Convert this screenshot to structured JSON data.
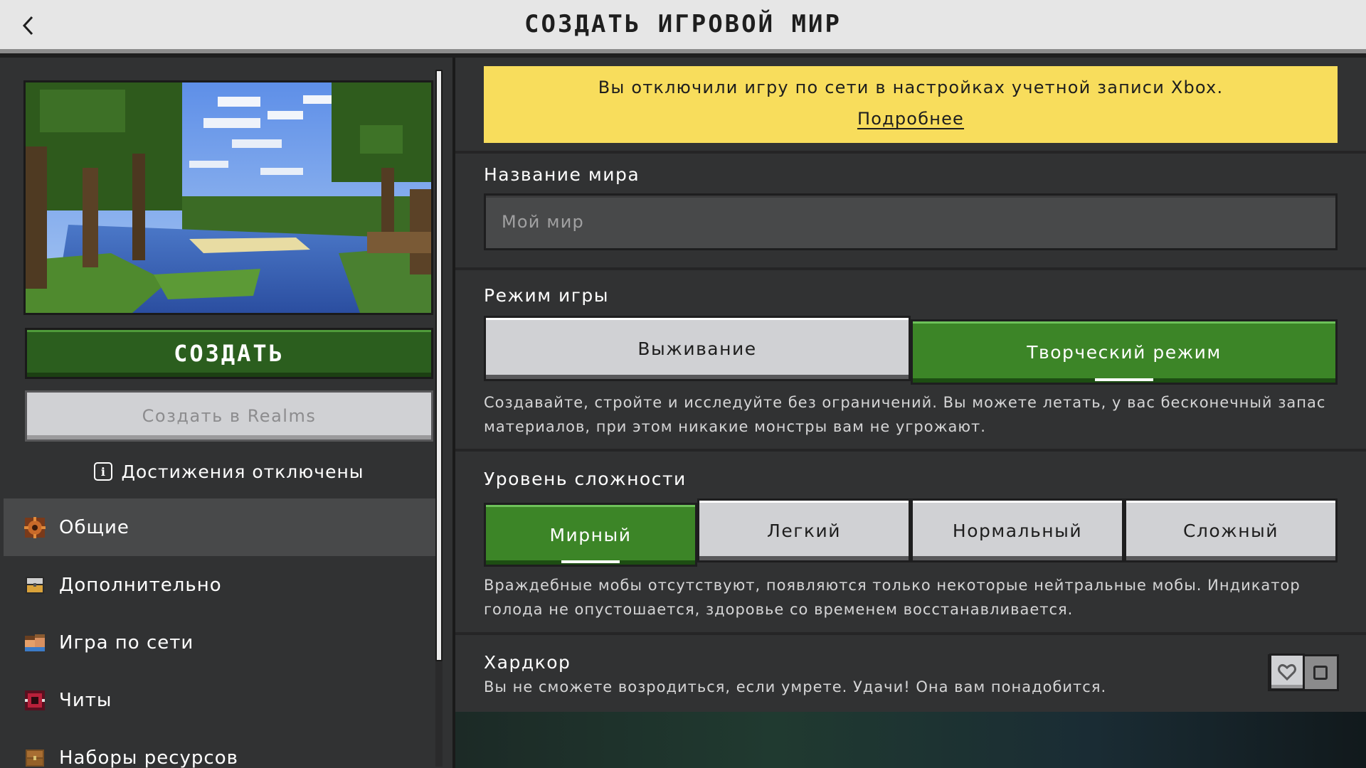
{
  "header": {
    "title": "СОЗДАТЬ ИГРОВОЙ МИР",
    "back_icon": "chevron-left-icon"
  },
  "left": {
    "create_label": "СОЗДАТЬ",
    "realms_label": "Создать в Realms",
    "achievements_text": "Достижения отключены",
    "nav": [
      {
        "label": "Общие",
        "icon": "gear-icon",
        "active": true
      },
      {
        "label": "Дополнительно",
        "icon": "chest-icon",
        "active": false
      },
      {
        "label": "Игра по сети",
        "icon": "players-icon",
        "active": false
      },
      {
        "label": "Читы",
        "icon": "cheats-icon",
        "active": false
      },
      {
        "label": "Наборы ресурсов",
        "icon": "resource-pack-icon",
        "active": false
      }
    ]
  },
  "banner": {
    "text": "Вы отключили игру по сети в настройках учетной записи Xbox.",
    "link": "Подробнее"
  },
  "world_name": {
    "label": "Название мира",
    "placeholder": "Мой мир"
  },
  "game_mode": {
    "label": "Режим игры",
    "options": [
      "Выживание",
      "Творческий режим"
    ],
    "selected": "Творческий режим",
    "description": "Создавайте, стройте и исследуйте без ограничений. Вы можете летать, у вас бесконечный запас материалов, при этом никакие монстры вам не угрожают."
  },
  "difficulty": {
    "label": "Уровень сложности",
    "options": [
      "Мирный",
      "Легкий",
      "Нормальный",
      "Сложный"
    ],
    "selected": "Мирный",
    "description": "Враждебные мобы отсутствуют, появляются только некоторые нейтральные мобы. Индикатор голода не опустошается, здоровье со временем восстанавливается."
  },
  "hardcore": {
    "label": "Хардкор",
    "description": "Вы не сможете возродиться, если умрете. Удачи! Она вам понадобится.",
    "enabled": false
  },
  "colors": {
    "green_button": "#3c8527",
    "banner_yellow": "#f8dd5c",
    "panel": "#313233"
  }
}
